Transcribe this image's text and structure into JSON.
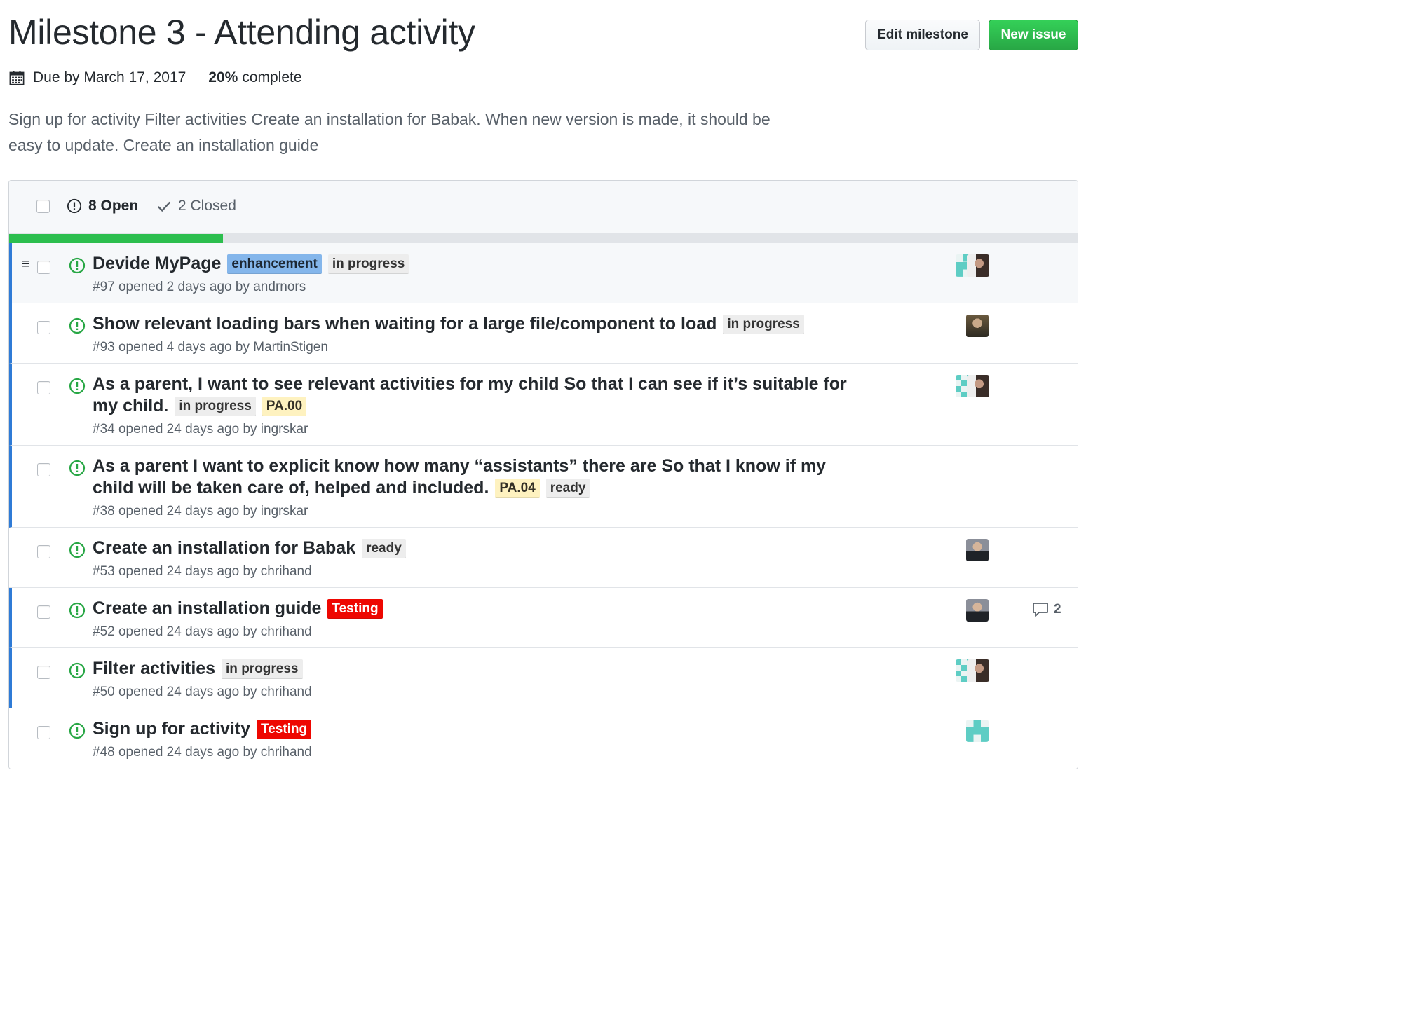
{
  "milestone": {
    "title": "Milestone 3 - Attending activity",
    "due": "Due by March 17, 2017",
    "percent": "20%",
    "percent_label": "complete",
    "progress_fraction": 0.2,
    "description": "Sign up for activity Filter activities Create an installation for Babak. When new version is made, it should be easy to update. Create an installation guide"
  },
  "buttons": {
    "edit": "Edit milestone",
    "new_issue": "New issue"
  },
  "states": {
    "open": "8 Open",
    "closed": "2 Closed"
  },
  "colors": {
    "open_icon": "#28a745",
    "progress": "#2cbe4e",
    "in_progress_bar": "#2f7bd6",
    "label_enhancement": "#84b6eb",
    "label_gray": "#ededed",
    "label_pa": "#fef2c0",
    "label_testing": "#ee0701"
  },
  "issues": [
    {
      "title": "Devide MyPage",
      "labels": [
        "enhancement",
        "in progress"
      ],
      "meta": "#97 opened 2 days ago by andrnors"
    },
    {
      "title": "Show relevant loading bars when waiting for a large file/component to load",
      "labels": [
        "in progress"
      ],
      "meta": "#93 opened 4 days ago by MartinStigen"
    },
    {
      "title": "As a parent, I want to see relevant activities for my child So that I can see if it’s suitable for my child.",
      "labels": [
        "in progress",
        "PA.00"
      ],
      "meta": "#34 opened 24 days ago by ingrskar"
    },
    {
      "title": "As a parent I want to explicit know how many “assistants” there are So that I know if my child will be taken care of, helped and included.",
      "labels": [
        "PA.04",
        "ready"
      ],
      "meta": "#38 opened 24 days ago by ingrskar"
    },
    {
      "title": "Create an installation for Babak",
      "labels": [
        "ready"
      ],
      "meta": "#53 opened 24 days ago by chrihand"
    },
    {
      "title": "Create an installation guide",
      "labels": [
        "Testing"
      ],
      "meta": "#52 opened 24 days ago by chrihand",
      "comments": "2"
    },
    {
      "title": "Filter activities",
      "labels": [
        "in progress"
      ],
      "meta": "#50 opened 24 days ago by chrihand"
    },
    {
      "title": "Sign up for activity",
      "labels": [
        "Testing"
      ],
      "meta": "#48 opened 24 days ago by chrihand"
    }
  ]
}
